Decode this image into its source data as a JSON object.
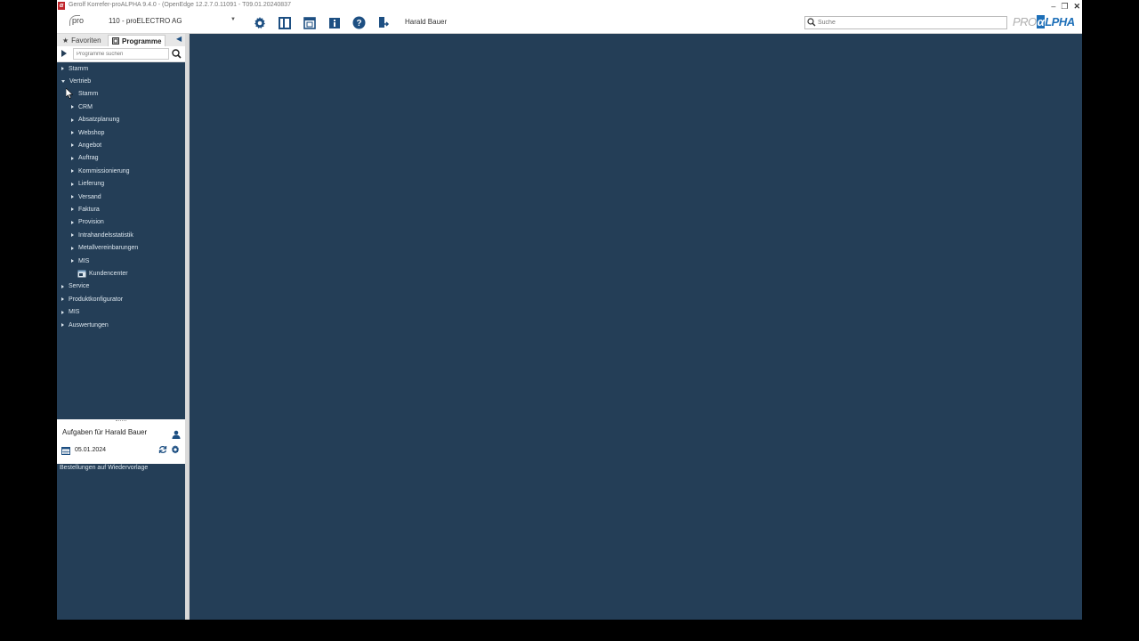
{
  "titlebar": {
    "title": "Gerolf Korrefer-proALPHA 9.4.0 - (OpenEdge 12.2.7.0.11091 - T09.01.20240837"
  },
  "toolbar": {
    "pro_label": "pro",
    "company": "110 - proELECTRO AG",
    "user": "Harald Bauer",
    "search_placeholder": "Suche",
    "icons": [
      "gear-icon",
      "panel-icon",
      "window-icon",
      "info-icon",
      "help-icon",
      "exit-icon"
    ]
  },
  "brand": {
    "part1": "PRO",
    "alpha": "α",
    "part2": "LPHA"
  },
  "sidebar": {
    "tabs": [
      {
        "label": "Favoriten",
        "active": false
      },
      {
        "label": "Programme",
        "active": true
      }
    ],
    "search_placeholder": "Programme suchen",
    "tree": [
      {
        "label": "Stamm",
        "level": 0,
        "expanded": false
      },
      {
        "label": "Vertrieb",
        "level": 0,
        "expanded": true
      },
      {
        "label": "Stamm",
        "level": 1,
        "expanded": false,
        "leaf_no_arrow": true
      },
      {
        "label": "CRM",
        "level": 1,
        "expanded": false
      },
      {
        "label": "Absatzplanung",
        "level": 1,
        "expanded": false
      },
      {
        "label": "Webshop",
        "level": 1,
        "expanded": false
      },
      {
        "label": "Angebot",
        "level": 1,
        "expanded": false
      },
      {
        "label": "Auftrag",
        "level": 1,
        "expanded": false
      },
      {
        "label": "Kommissionierung",
        "level": 1,
        "expanded": false
      },
      {
        "label": "Lieferung",
        "level": 1,
        "expanded": false
      },
      {
        "label": "Versand",
        "level": 1,
        "expanded": false
      },
      {
        "label": "Faktura",
        "level": 1,
        "expanded": false
      },
      {
        "label": "Provision",
        "level": 1,
        "expanded": false
      },
      {
        "label": "Intrahandelsstatistik",
        "level": 1,
        "expanded": false
      },
      {
        "label": "Metallvereinbarungen",
        "level": 1,
        "expanded": false
      },
      {
        "label": "MIS",
        "level": 1,
        "expanded": false
      },
      {
        "label": "Kundencenter",
        "level": 1,
        "program": true
      },
      {
        "label": "Service",
        "level": 0,
        "expanded": false
      },
      {
        "label": "Produktkonfigurator",
        "level": 0,
        "expanded": false
      },
      {
        "label": "MIS",
        "level": 0,
        "expanded": false
      },
      {
        "label": "Auswertungen",
        "level": 0,
        "expanded": false
      }
    ]
  },
  "tasks": {
    "title": "Aufgaben für Harald Bauer",
    "date": "05.01.2024",
    "items": [
      "Bestellungen auf Wiedervorlage"
    ]
  },
  "colors": {
    "panel": "#243e57",
    "accent": "#1d6fb8",
    "logo_red": "#c0262c"
  }
}
